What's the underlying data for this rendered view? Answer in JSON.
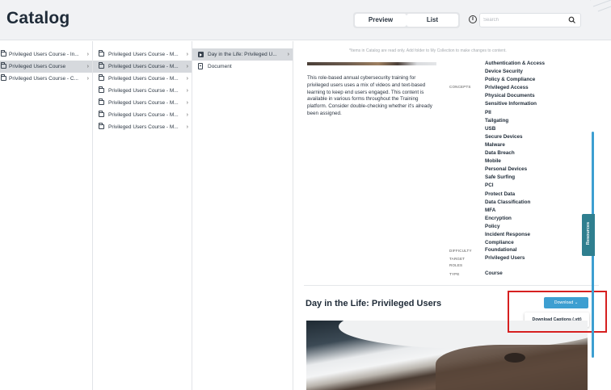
{
  "app_title": "Catalog",
  "view_toggle": {
    "preview": "Preview",
    "list": "List",
    "active": "List"
  },
  "search": {
    "placeholder": "Search"
  },
  "columns": {
    "col1": [
      {
        "label": "Privileged Users Course - In...",
        "selected": false
      },
      {
        "label": "Privileged Users Course",
        "selected": true
      },
      {
        "label": "Privileged Users Course - C...",
        "selected": false
      }
    ],
    "col2": [
      {
        "label": "Privileged Users Course - M...",
        "selected": false
      },
      {
        "label": "Privileged Users Course - M...",
        "selected": true
      },
      {
        "label": "Privileged Users Course - M...",
        "selected": false
      },
      {
        "label": "Privileged Users Course - M...",
        "selected": false
      },
      {
        "label": "Privileged Users Course - M...",
        "selected": false
      },
      {
        "label": "Privileged Users Course - M...",
        "selected": false
      },
      {
        "label": "Privileged Users Course - M...",
        "selected": false
      }
    ],
    "col3": [
      {
        "label": "Day in the Life: Privileged U...",
        "type": "video",
        "selected": true
      },
      {
        "label": "Document",
        "type": "document",
        "selected": false
      }
    ]
  },
  "preview": {
    "notice": "*Items in Catalog are read only. Add folder to My Collection to make changes to content.",
    "description": "This role-based annual cybersecurity training for privileged users uses a mix of videos and text-based learning to keep end users engaged. This content is available in various forms throughout the Training platform. Consider double-checking whether it's already been assigned.",
    "concepts_label": "CONCEPTS",
    "concepts": [
      "Authentication & Access",
      "Device Security",
      "Policy & Compliance",
      "Privileged Access",
      "Physical Documents",
      "Sensitive Information",
      "PII",
      "Tailgating",
      "USB",
      "Secure Devices",
      "Malware",
      "Data Breach",
      "Mobile",
      "Personal Devices",
      "Safe Surfing",
      "PCI",
      "Protect Data",
      "Data Classification",
      "MFA",
      "Encryption",
      "Policy",
      "Incident Response",
      "Compliance"
    ],
    "difficulty_label": "DIFFICULTY",
    "difficulty": "Foundational",
    "target_roles_label_1": "TARGET",
    "target_roles_label_2": "ROLES",
    "target_roles": "Privileged Users",
    "type_label": "TYPE",
    "type": "Course",
    "course_title": "Day in the Life: Privileged Users",
    "download_button": "Download",
    "download_menu_item": "Download Captions (.vtt)"
  },
  "resources_tab": "Resources",
  "colors": {
    "accent": "#3d9fd1",
    "highlight": "#d62020",
    "resources": "#2f7f8f"
  }
}
